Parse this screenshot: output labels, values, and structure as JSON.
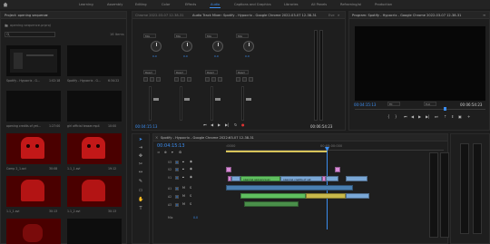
{
  "workspace": {
    "tabs": [
      "Learning",
      "Assembly",
      "Editing",
      "Color",
      "Effects",
      "Audio",
      "Captions and Graphics",
      "Libraries",
      "All Panels",
      "Reframing/ai",
      "Production"
    ],
    "active_tab": "Audio"
  },
  "project_panel": {
    "title": "Project: opening sequence",
    "file": "opening sequence.prproj",
    "item_count": "16 Items",
    "clips": [
      {
        "name": "Spotify - Hypocrix - G...",
        "duration": "1:02:18"
      },
      {
        "name": "Spotify - Hypocrix - G...",
        "duration": "6:34:22"
      },
      {
        "name": "opening credits of yet...",
        "duration": "1:27:00"
      },
      {
        "name": "girl official teaser.mp4",
        "duration": "10:00"
      },
      {
        "name": "Comp 2_1.avi",
        "duration": "30:08"
      },
      {
        "name": "1.1_1.avi",
        "duration": "19:12"
      },
      {
        "name": "1.1_1.avi",
        "duration": "30:13"
      },
      {
        "name": "1.1_2.avi",
        "duration": "30:13"
      }
    ]
  },
  "source_panel": {
    "tab_source": "Chrome 2022-03-07 12-38-31",
    "tab_mixer": "Audio Track Mixer: Spotify - Hypocrix - Google Chrome 2022-03-07 12-38-31",
    "tab_more": "Eve",
    "channels": [
      {
        "dd": "Mix",
        "read": "Read",
        "value": "0.0"
      },
      {
        "dd": "Mix",
        "read": "Read",
        "value": "0.0"
      },
      {
        "dd": "Mix",
        "read": "Read",
        "value": "0.0"
      },
      {
        "dd": "Mix",
        "read": "Read",
        "value": "0.0"
      }
    ],
    "timecode_left": "00:04:15:13",
    "timecode_right": "00:06:54:23"
  },
  "program_monitor": {
    "title": "Program: Spotify - Hypocrix - Google Chrome 2022-03-07 12-38-31",
    "timecode": "00:04:15:13",
    "fit": "Fit",
    "quality": "Full",
    "duration": "00:06:54:23"
  },
  "timeline": {
    "title": "Spotify - Hypocrix - Google Chrome 2022-03-07 12-38-31",
    "timecode": "00:04:15:13",
    "ruler_start": ":0000",
    "ruler_mark": "00:05:00:000",
    "tracks": [
      "V3",
      "V2",
      "V1",
      "A1",
      "A2",
      "A3",
      "Mix"
    ],
    "mix_value": "0.0",
    "clips": [
      {
        "label": "opening sequence.av"
      },
      {
        "label": "opening credits of yet"
      }
    ]
  },
  "colors": {
    "accent": "#3b8df0",
    "video_clip": "#7aa7d6",
    "audio_clip": "#5fbf5f",
    "pink_clip": "#d98ad8",
    "playhead": "#3b8df0"
  }
}
